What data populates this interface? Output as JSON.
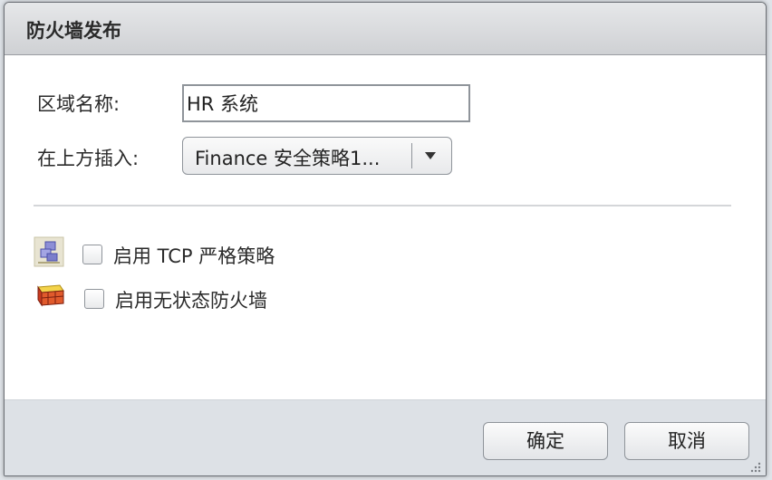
{
  "dialog": {
    "title": "防火墙发布",
    "zone_name_label": "区域名称:",
    "zone_name_value": "HR 系统",
    "insert_above_label": "在上方插入:",
    "insert_above_selected": "Finance 安全策略1...",
    "tcp_strict_label": "启用 TCP 严格策略",
    "tcp_strict_checked": false,
    "stateless_label": "启用无状态防火墙",
    "stateless_checked": false,
    "ok_label": "确定",
    "cancel_label": "取消"
  },
  "icons": {
    "tcp_strict": "network-policy-icon",
    "stateless": "firewall-brick-icon",
    "dropdown": "chevron-down-icon",
    "resize": "resize-grip-icon"
  },
  "colors": {
    "title_bar": "#d9dadc",
    "footer": "#dde1e6",
    "border": "#8f949a"
  }
}
